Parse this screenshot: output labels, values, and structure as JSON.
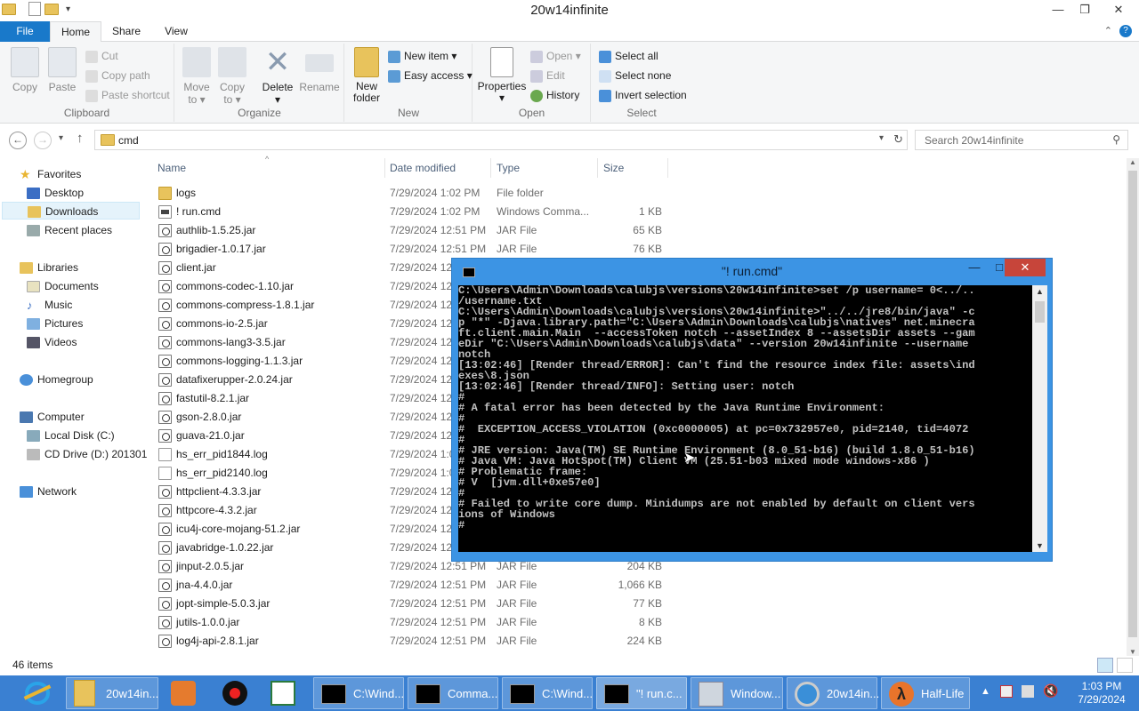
{
  "window": {
    "title": "20w14infinite",
    "minimize": "—",
    "maximize": "❐",
    "close": "✕"
  },
  "ribbon_tabs": [
    "File",
    "Home",
    "Share",
    "View"
  ],
  "ribbon": {
    "clipboard": {
      "label": "Clipboard",
      "copy": "Copy",
      "paste": "Paste",
      "cut": "Cut",
      "copy_path": "Copy path",
      "paste_shortcut": "Paste shortcut"
    },
    "organize": {
      "label": "Organize",
      "move_to": "Move to ▾",
      "copy_to": "Copy to ▾",
      "delete": "Delete ▾",
      "rename": "Rename"
    },
    "new": {
      "label": "New",
      "new_folder": "New folder",
      "new_item": "New item ▾",
      "easy_access": "Easy access ▾"
    },
    "open": {
      "label": "Open",
      "properties": "Properties ▾",
      "open": "Open ▾",
      "edit": "Edit",
      "history": "History"
    },
    "select": {
      "label": "Select",
      "select_all": "Select all",
      "select_none": "Select none",
      "invert_selection": "Invert selection"
    }
  },
  "address": {
    "path": "cmd",
    "search_placeholder": "Search 20w14infinite"
  },
  "nav": {
    "favorites": "Favorites",
    "desktop": "Desktop",
    "downloads": "Downloads",
    "recent_places": "Recent places",
    "libraries": "Libraries",
    "documents": "Documents",
    "music": "Music",
    "pictures": "Pictures",
    "videos": "Videos",
    "homegroup": "Homegroup",
    "computer": "Computer",
    "local_disk": "Local Disk (C:)",
    "cd_drive": "CD Drive (D:) 201301",
    "network": "Network"
  },
  "columns": {
    "name": "Name",
    "date": "Date modified",
    "type": "Type",
    "size": "Size"
  },
  "files": [
    {
      "name": "logs",
      "date": "7/29/2024 1:02 PM",
      "type": "File folder",
      "size": "",
      "icon": "folder"
    },
    {
      "name": "! run.cmd",
      "date": "7/29/2024 1:02 PM",
      "type": "Windows Comma...",
      "size": "1 KB",
      "icon": "cmd"
    },
    {
      "name": "authlib-1.5.25.jar",
      "date": "7/29/2024 12:51 PM",
      "type": "JAR File",
      "size": "65 KB",
      "icon": "jar"
    },
    {
      "name": "brigadier-1.0.17.jar",
      "date": "7/29/2024 12:51 PM",
      "type": "JAR File",
      "size": "76 KB",
      "icon": "jar"
    },
    {
      "name": "client.jar",
      "date": "7/29/2024 12",
      "type": "",
      "size": "",
      "icon": "jar"
    },
    {
      "name": "commons-codec-1.10.jar",
      "date": "7/29/2024 12",
      "type": "",
      "size": "",
      "icon": "jar"
    },
    {
      "name": "commons-compress-1.8.1.jar",
      "date": "7/29/2024 12",
      "type": "",
      "size": "",
      "icon": "jar"
    },
    {
      "name": "commons-io-2.5.jar",
      "date": "7/29/2024 12",
      "type": "",
      "size": "",
      "icon": "jar"
    },
    {
      "name": "commons-lang3-3.5.jar",
      "date": "7/29/2024 12",
      "type": "",
      "size": "",
      "icon": "jar"
    },
    {
      "name": "commons-logging-1.1.3.jar",
      "date": "7/29/2024 12",
      "type": "",
      "size": "",
      "icon": "jar"
    },
    {
      "name": "datafixerupper-2.0.24.jar",
      "date": "7/29/2024 12",
      "type": "",
      "size": "",
      "icon": "jar"
    },
    {
      "name": "fastutil-8.2.1.jar",
      "date": "7/29/2024 12",
      "type": "",
      "size": "",
      "icon": "jar"
    },
    {
      "name": "gson-2.8.0.jar",
      "date": "7/29/2024 12",
      "type": "",
      "size": "",
      "icon": "jar"
    },
    {
      "name": "guava-21.0.jar",
      "date": "7/29/2024 12",
      "type": "",
      "size": "",
      "icon": "jar"
    },
    {
      "name": "hs_err_pid1844.log",
      "date": "7/29/2024 1:0",
      "type": "",
      "size": "",
      "icon": "log"
    },
    {
      "name": "hs_err_pid2140.log",
      "date": "7/29/2024 1:0",
      "type": "",
      "size": "",
      "icon": "log"
    },
    {
      "name": "httpclient-4.3.3.jar",
      "date": "7/29/2024 12",
      "type": "",
      "size": "",
      "icon": "jar"
    },
    {
      "name": "httpcore-4.3.2.jar",
      "date": "7/29/2024 12",
      "type": "",
      "size": "",
      "icon": "jar"
    },
    {
      "name": "icu4j-core-mojang-51.2.jar",
      "date": "7/29/2024 12",
      "type": "",
      "size": "",
      "icon": "jar"
    },
    {
      "name": "javabridge-1.0.22.jar",
      "date": "7/29/2024 12",
      "type": "",
      "size": "",
      "icon": "jar"
    },
    {
      "name": "jinput-2.0.5.jar",
      "date": "7/29/2024 12:51 PM",
      "type": "JAR File",
      "size": "204 KB",
      "icon": "jar"
    },
    {
      "name": "jna-4.4.0.jar",
      "date": "7/29/2024 12:51 PM",
      "type": "JAR File",
      "size": "1,066 KB",
      "icon": "jar"
    },
    {
      "name": "jopt-simple-5.0.3.jar",
      "date": "7/29/2024 12:51 PM",
      "type": "JAR File",
      "size": "77 KB",
      "icon": "jar"
    },
    {
      "name": "jutils-1.0.0.jar",
      "date": "7/29/2024 12:51 PM",
      "type": "JAR File",
      "size": "8 KB",
      "icon": "jar"
    },
    {
      "name": "log4j-api-2.8.1.jar",
      "date": "7/29/2024 12:51 PM",
      "type": "JAR File",
      "size": "224 KB",
      "icon": "jar"
    }
  ],
  "status": {
    "items": "46 items"
  },
  "console": {
    "title": "\"! run.cmd\"",
    "lines": [
      "C:\\Users\\Admin\\Downloads\\calubjs\\versions\\20w14infinite>set /p username= 0<../..",
      "/username.txt",
      "",
      "C:\\Users\\Admin\\Downloads\\calubjs\\versions\\20w14infinite>\"../../jre8/bin/java\" -c",
      "p \"*\" -Djava.library.path=\"C:\\Users\\Admin\\Downloads\\calubjs\\natives\" net.minecra",
      "ft.client.main.Main  --accessToken notch --assetIndex 8 --assetsDir assets --gam",
      "eDir \"C:\\Users\\Admin\\Downloads\\calubjs\\data\" --version 20w14infinite --username",
      "notch",
      "[13:02:46] [Render thread/ERROR]: Can't find the resource index file: assets\\ind",
      "exes\\8.json",
      "[13:02:46] [Render thread/INFO]: Setting user: notch",
      "#",
      "# A fatal error has been detected by the Java Runtime Environment:",
      "#",
      "#  EXCEPTION_ACCESS_VIOLATION (0xc0000005) at pc=0x732957e0, pid=2140, tid=4072",
      "#",
      "# JRE version: Java(TM) SE Runtime Environment (8.0_51-b16) (build 1.8.0_51-b16)",
      "",
      "# Java VM: Java HotSpot(TM) Client VM (25.51-b03 mixed mode windows-x86 )",
      "# Problematic frame:",
      "# V  [jvm.dll+0xe57e0]",
      "#",
      "# Failed to write core dump. Minidumps are not enabled by default on client vers",
      "ions of Windows",
      "#"
    ]
  },
  "taskbar": {
    "items": [
      "20w14in...",
      "C:\\Wind...",
      "Comma...",
      "C:\\Wind...",
      "\"! run.c...",
      "Window...",
      "20w14in...",
      "Half-Life"
    ],
    "time": "1:03 PM",
    "date": "7/29/2024"
  },
  "colors": {
    "accent": "#1979ca",
    "taskbar": "#3a80d2",
    "console_frame": "#3c94e4",
    "close_red": "#c7453a"
  }
}
